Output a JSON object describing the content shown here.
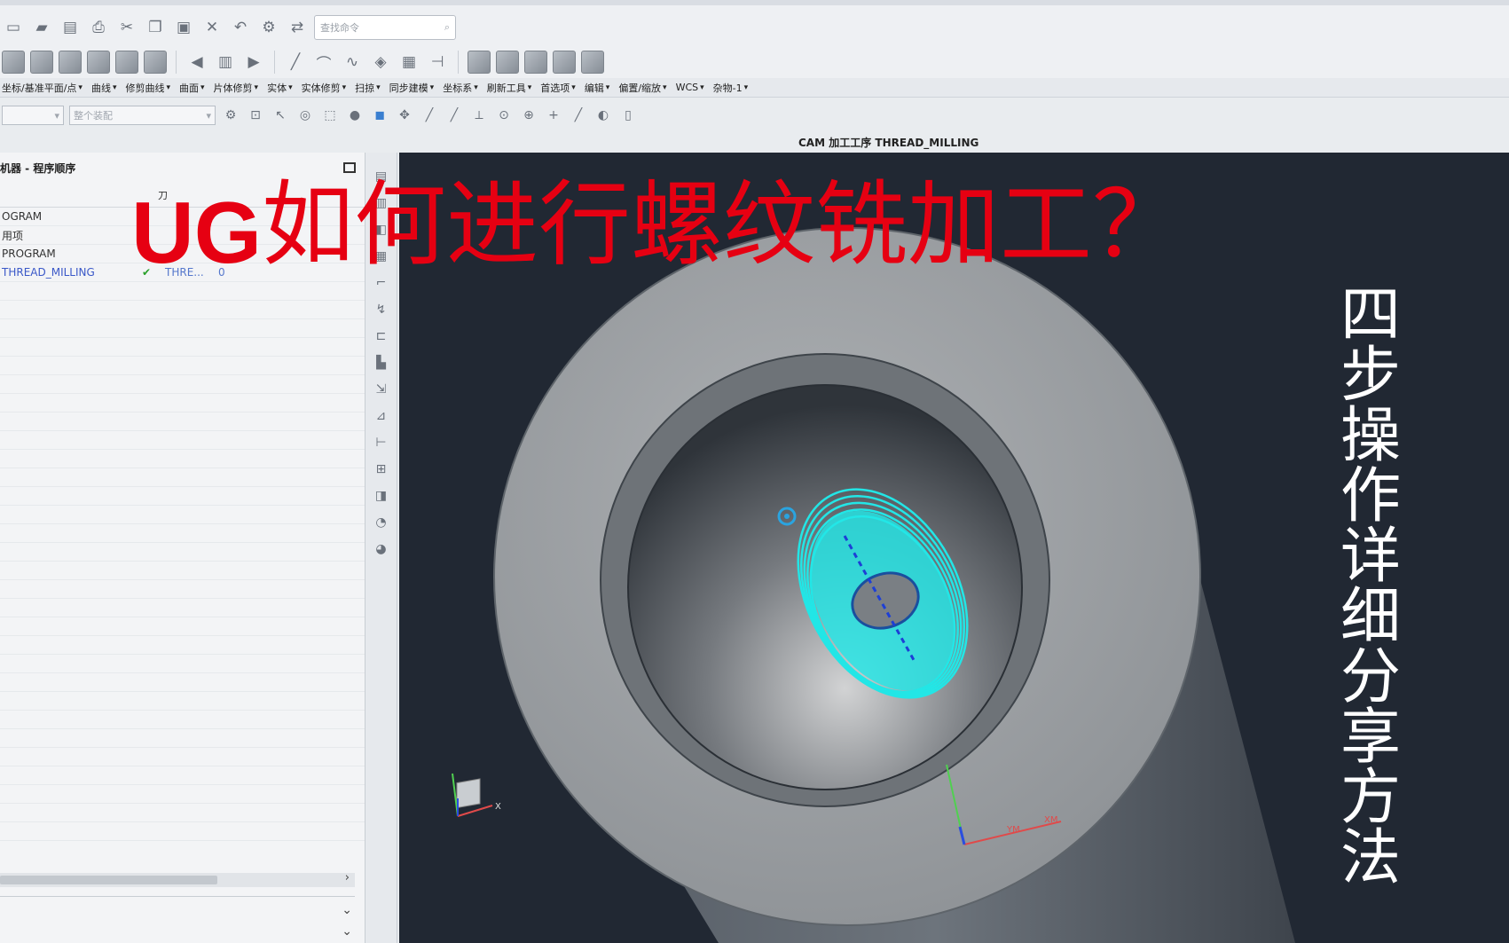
{
  "toolbar": {
    "search_placeholder": "查找命令",
    "menus": [
      "坐标/基准平面/点",
      "曲线",
      "修剪曲线",
      "曲面",
      "片体修剪",
      "实体",
      "实体修剪",
      "扫掠",
      "同步建模",
      "坐标系",
      "刷新工具",
      "首选项",
      "编辑",
      "偏置/缩放",
      "WCS",
      "杂物-1"
    ],
    "filter_placeholder": "整个装配"
  },
  "viewport": {
    "title": "CAM 加工工序 THREAD_MILLING"
  },
  "navigator": {
    "title": "机器 - 程序顺序",
    "column_header": "刀",
    "rows": [
      {
        "name": "OGRAM",
        "check": "",
        "tool": "",
        "time": ""
      },
      {
        "name": "用项",
        "check": "",
        "tool": "",
        "time": ""
      },
      {
        "name": "PROGRAM",
        "check": "",
        "tool": "",
        "time": ""
      },
      {
        "name": "THREAD_MILLING",
        "check": "✔",
        "tool": "THRE...",
        "time": "0"
      }
    ]
  },
  "overlay": {
    "headline_latin": "UG",
    "headline_cn": "如何进行螺纹铣加工？",
    "side_text": "四步操作详细分享方法"
  },
  "axis_labels": {
    "x": "X",
    "xm": "XM",
    "ym": "YM"
  },
  "colors": {
    "headline": "#e60012",
    "viewport_bg": "#212833",
    "toolpath": "#22e6e6"
  }
}
